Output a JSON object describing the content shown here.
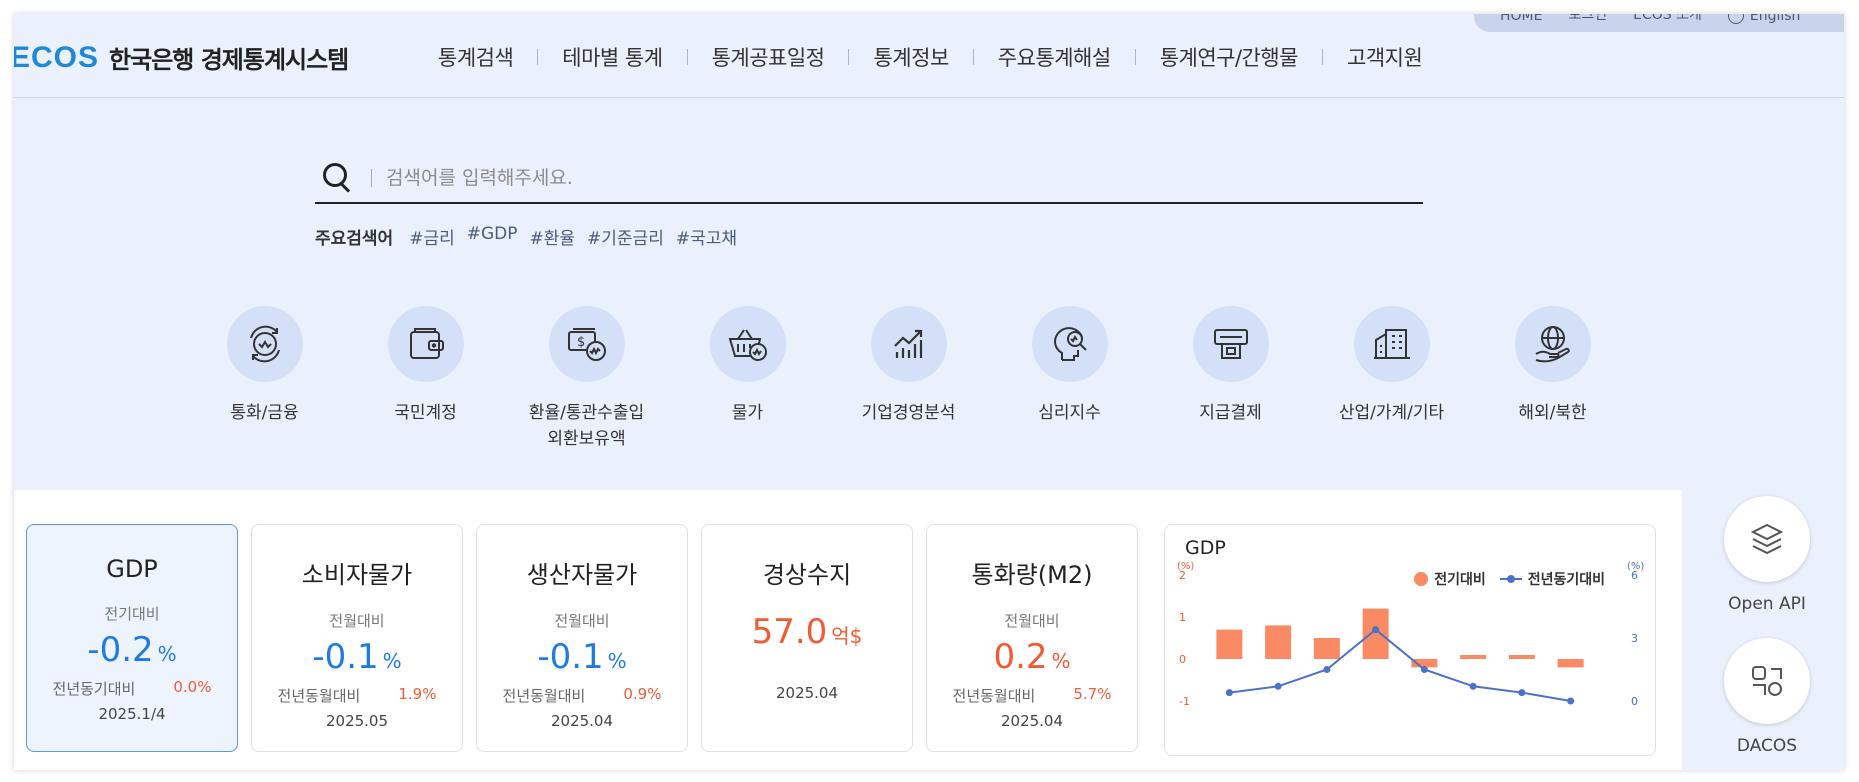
{
  "utility": {
    "items": [
      "HOME",
      "로그인",
      "ECOS 소개",
      "English"
    ]
  },
  "header": {
    "logo_mark": "ECOS",
    "logo_text": "한국은행 경제통계시스템",
    "nav": [
      "통계검색",
      "테마별 통계",
      "통계공표일정",
      "통계정보",
      "주요통계해설",
      "통계연구/간행물",
      "고객지원"
    ]
  },
  "search": {
    "placeholder": "검색어를 입력해주세요.",
    "keywords_label": "주요검색어",
    "keywords": [
      "#금리",
      "#GDP",
      "#환율",
      "#기준금리",
      "#국고채"
    ]
  },
  "categories": [
    {
      "label": "통화/금융",
      "icon": "currency-cycle-icon"
    },
    {
      "label": "국민계정",
      "icon": "wallet-icon"
    },
    {
      "label": "환율/통관수출입\n외환보유액",
      "icon": "exchange-money-icon"
    },
    {
      "label": "물가",
      "icon": "basket-icon"
    },
    {
      "label": "기업경영분석",
      "icon": "bar-growth-icon"
    },
    {
      "label": "심리지수",
      "icon": "head-search-icon"
    },
    {
      "label": "지급결제",
      "icon": "payment-terminal-icon"
    },
    {
      "label": "산업/가계/기타",
      "icon": "building-icon"
    },
    {
      "label": "해외/북한",
      "icon": "globe-hand-icon"
    }
  ],
  "stats": [
    {
      "title": "GDP",
      "sub": "전기대비",
      "value": "-0.2",
      "unit": "%",
      "color": "blue",
      "cmp_label": "전년동기대비",
      "cmp_value": "0.0%",
      "date": "2025.1/4",
      "active": true
    },
    {
      "title": "소비자물가",
      "sub": "전월대비",
      "value": "-0.1",
      "unit": "%",
      "color": "blue",
      "cmp_label": "전년동월대비",
      "cmp_value": "1.9%",
      "date": "2025.05",
      "active": false
    },
    {
      "title": "생산자물가",
      "sub": "전월대비",
      "value": "-0.1",
      "unit": "%",
      "color": "blue",
      "cmp_label": "전년동월대비",
      "cmp_value": "0.9%",
      "date": "2025.04",
      "active": false
    },
    {
      "title": "경상수지",
      "sub": "",
      "value": "57.0",
      "unit": "억$",
      "color": "red",
      "cmp_label": "",
      "cmp_value": "",
      "date": "2025.04",
      "active": false
    },
    {
      "title": "통화량(M2)",
      "sub": "전월대비",
      "value": "0.2",
      "unit": "%",
      "color": "red",
      "cmp_label": "전년동월대비",
      "cmp_value": "5.7%",
      "date": "2025.04",
      "active": false
    }
  ],
  "chart_data": {
    "type": "bar",
    "title": "GDP",
    "categories": [
      "",
      "",
      "",
      "",
      "",
      "",
      "",
      ""
    ],
    "series": [
      {
        "name": "전기대비",
        "kind": "bar",
        "axis": "left",
        "color": "#fa8a64",
        "values": [
          0.7,
          0.8,
          0.5,
          1.2,
          -0.2,
          0.0,
          0.0,
          -0.2
        ]
      },
      {
        "name": "전년동기대비",
        "kind": "line",
        "axis": "right",
        "color": "#4c71c9",
        "values": [
          0.4,
          0.7,
          1.5,
          3.4,
          1.5,
          0.7,
          0.4,
          0.0
        ]
      }
    ],
    "left_axis": {
      "unit": "(%)",
      "ticks": [
        "2",
        "1",
        "0",
        "-1"
      ],
      "range": [
        -1,
        2
      ]
    },
    "right_axis": {
      "unit": "(%)",
      "ticks": [
        "6",
        "3",
        "0"
      ],
      "range": [
        0,
        6
      ]
    },
    "legend_position": "top-right",
    "colors": {
      "bar": "#fa8a64",
      "line": "#4c71c9",
      "left_axis": "#f05a35",
      "right_axis": "#4c71c9"
    }
  },
  "quick_links": [
    {
      "label": "Open API",
      "icon": "layers-icon"
    },
    {
      "label": "DACOS",
      "icon": "shapes-icon"
    }
  ]
}
